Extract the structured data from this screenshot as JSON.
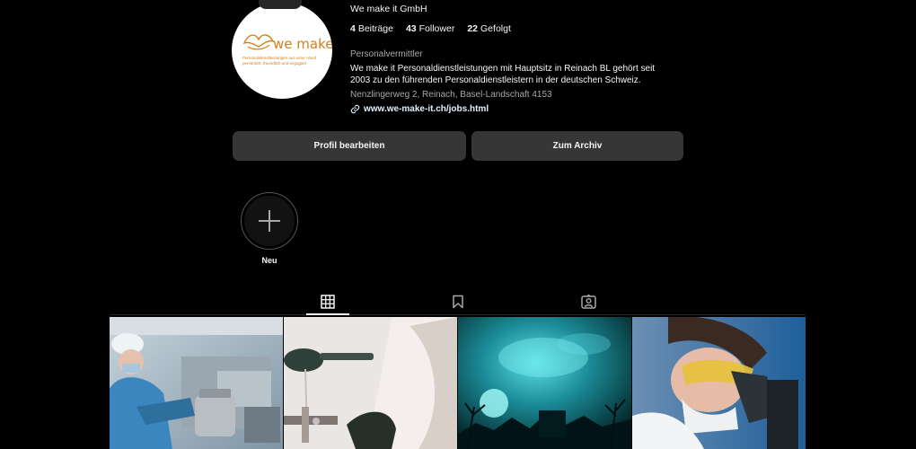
{
  "profile": {
    "name": "We make it GmbH",
    "logo_text": "we make it",
    "logo_tagline_1": "Personaldienstleistungen aus einer Hand",
    "logo_tagline_2": "persönlich, freundlich und engagiert",
    "stats": [
      {
        "count": "4",
        "label": "Beiträge"
      },
      {
        "count": "43",
        "label": "Follower"
      },
      {
        "count": "22",
        "label": "Gefolgt"
      }
    ],
    "category": "Personalvermittler",
    "bio": "We make it Personaldienstleistungen mit Hauptsitz in Reinach BL gehört seit 2003 zu den führenden Personaldienstleistern in der deutschen Schweiz.",
    "address": "Nenzlingerweg 2, Reinach, Basel-Landschaft 4153",
    "link": "www.we-make-it.ch/jobs.html"
  },
  "actions": {
    "edit_profile": "Profil bearbeiten",
    "archive": "Zum Archiv"
  },
  "story": {
    "new_label": "Neu"
  },
  "tabs": [
    {
      "icon": "grid-icon",
      "active": true
    },
    {
      "icon": "bookmark-icon",
      "active": false
    },
    {
      "icon": "tagged-user-icon",
      "active": false
    }
  ],
  "posts": [
    {
      "icon": "post-image-lab-worker"
    },
    {
      "icon": "post-image-lab-gloves"
    },
    {
      "icon": "post-image-teal-sky"
    },
    {
      "icon": "post-image-microscope"
    }
  ],
  "colors": {
    "background": "#000000",
    "button": "#363636",
    "muted_text": "#a8a8a8",
    "logo_orange": "#d27f1a"
  }
}
